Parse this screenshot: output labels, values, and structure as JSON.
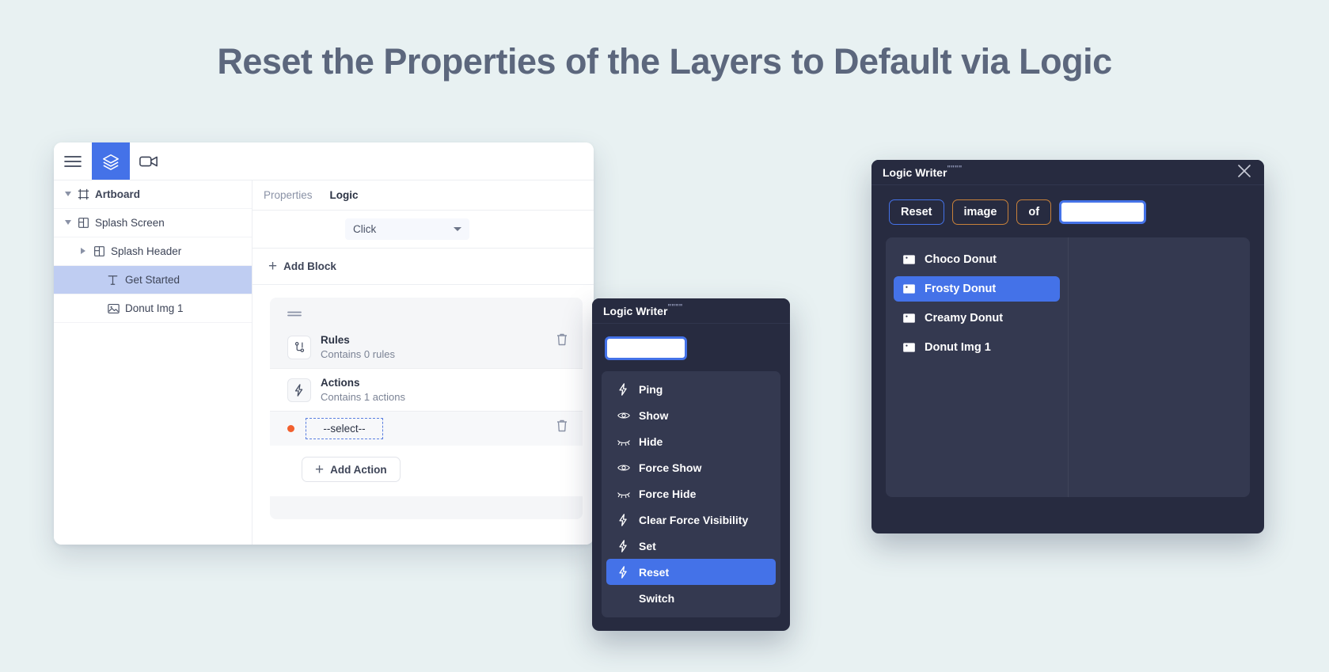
{
  "page": {
    "title": "Reset the Properties of the Layers to Default via Logic",
    "background_color": "#e8f1f2",
    "title_color": "#5c677d",
    "accent_blue": "#4472e8",
    "accent_orange": "#f2602e",
    "amber_border": "#c8813a"
  },
  "app": {
    "toolbar": [
      {
        "name": "menu-icon",
        "icon": "hamburger",
        "active": false
      },
      {
        "name": "layers-icon",
        "icon": "layers",
        "active": true
      },
      {
        "name": "video-icon",
        "icon": "video-camera",
        "active": false
      }
    ],
    "layers": [
      {
        "label": "Artboard",
        "icon": "artboard-icon",
        "level": 0,
        "caret": "down",
        "selected": false
      },
      {
        "label": "Splash Screen",
        "icon": "frame-icon",
        "level": 1,
        "caret": "down",
        "selected": false
      },
      {
        "label": "Splash Header",
        "icon": "frame-icon",
        "level": 2,
        "caret": "right",
        "selected": false
      },
      {
        "label": "Get Started",
        "icon": "text-icon",
        "level": 3,
        "caret": "none",
        "selected": true
      },
      {
        "label": "Donut Img 1",
        "icon": "image-icon",
        "level": 3,
        "caret": "none",
        "selected": false
      }
    ],
    "tabs": [
      {
        "label": "Properties",
        "active": false
      },
      {
        "label": "Logic",
        "active": true
      }
    ],
    "trigger": {
      "value": "Click"
    },
    "add_block_label": "Add Block",
    "block": {
      "rules": {
        "title": "Rules",
        "subtitle": "Contains 0 rules"
      },
      "actions": {
        "title": "Actions",
        "subtitle": "Contains 1 actions"
      },
      "action_row": {
        "value": "--select--"
      },
      "add_action_label": "Add Action"
    }
  },
  "logic_writer_actions": {
    "title": "Logic Writer",
    "title_suffix": "\"\"\"\"",
    "search_value": "",
    "options": [
      {
        "label": "Ping",
        "icon": "bolt-icon",
        "selected": false
      },
      {
        "label": "Show",
        "icon": "eye-icon",
        "selected": false
      },
      {
        "label": "Hide",
        "icon": "eye-off-icon",
        "selected": false
      },
      {
        "label": "Force Show",
        "icon": "eye-icon",
        "selected": false
      },
      {
        "label": "Force Hide",
        "icon": "eye-off-icon",
        "selected": false
      },
      {
        "label": "Clear Force Visibility",
        "icon": "bolt-icon",
        "selected": false
      },
      {
        "label": "Set",
        "icon": "bolt-icon",
        "selected": false
      },
      {
        "label": "Reset",
        "icon": "bolt-icon",
        "selected": true
      },
      {
        "label": "Switch",
        "icon": "none",
        "selected": false
      }
    ]
  },
  "logic_writer_target": {
    "title": "Logic Writer",
    "title_suffix": "\"\"\"\"",
    "close_label": "×",
    "crumbs": [
      {
        "label": "Reset",
        "style": "blue"
      },
      {
        "label": "image",
        "style": "amber"
      },
      {
        "label": "of",
        "style": "amber"
      }
    ],
    "input_value": "",
    "layers": [
      {
        "label": "Choco Donut",
        "icon": "image-icon",
        "selected": false
      },
      {
        "label": "Frosty Donut",
        "icon": "image-icon",
        "selected": true
      },
      {
        "label": "Creamy Donut",
        "icon": "image-icon",
        "selected": false
      },
      {
        "label": "Donut Img 1",
        "icon": "image-icon",
        "selected": false
      }
    ]
  }
}
